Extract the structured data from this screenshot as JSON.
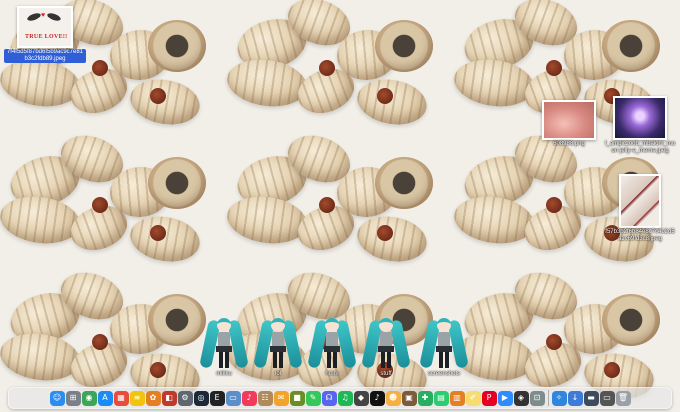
{
  "desktop": {
    "icons": [
      {
        "id": "truelove",
        "label": "7f4f5d5f87bd6f5b9ac9c7e81b3c2fdb89.jpeg",
        "thumb_text": "TRUE LOVE!!",
        "selected": true
      },
      {
        "id": "pink",
        "label": "608988.png",
        "selected": false
      },
      {
        "id": "jelly",
        "label": "f_ampiczoob_mbalom_moon-jelly-e_meme.jpeg",
        "selected": false
      },
      {
        "id": "wings",
        "label": "f57b3b2f6b84e8c7c4b2d5a1c69fd3c8.jpeg",
        "selected": false
      },
      {
        "id": "miku1",
        "label": "mikku",
        "selected": false
      },
      {
        "id": "miku2",
        "label": "lol",
        "selected": false
      },
      {
        "id": "miku3",
        "label": "hmm",
        "selected": false
      },
      {
        "id": "miku4",
        "label": "stuff",
        "selected": false
      },
      {
        "id": "miku5",
        "label": "screenshots",
        "selected": false
      }
    ]
  },
  "dock": {
    "apps": [
      {
        "icon": "finder-icon",
        "glyph": "☺",
        "color": "#2a8df0"
      },
      {
        "icon": "launchpad-icon",
        "glyph": "⊞",
        "color": "#7a7f88"
      },
      {
        "icon": "chrome-icon",
        "glyph": "◉",
        "color": "#3aa757"
      },
      {
        "icon": "app-store-icon",
        "glyph": "A",
        "color": "#1a8cf7"
      },
      {
        "icon": "calendar-icon",
        "glyph": "▦",
        "color": "#e74c3c"
      },
      {
        "icon": "notes-icon",
        "glyph": "≡",
        "color": "#f1c40f"
      },
      {
        "icon": "photos-icon",
        "glyph": "✿",
        "color": "#e67e22"
      },
      {
        "icon": "photo-booth-icon",
        "glyph": "◧",
        "color": "#c0392b"
      },
      {
        "icon": "system-preferences-icon",
        "glyph": "⚙",
        "color": "#5f6670"
      },
      {
        "icon": "steam-icon",
        "glyph": "◎",
        "color": "#1b2838"
      },
      {
        "icon": "epic-games-icon",
        "glyph": "E",
        "color": "#222"
      },
      {
        "icon": "preview-icon",
        "glyph": "▭",
        "color": "#5b8fc9"
      },
      {
        "icon": "music-icon",
        "glyph": "♪",
        "color": "#f23b5b"
      },
      {
        "icon": "contacts-icon",
        "glyph": "☷",
        "color": "#b08a5a"
      },
      {
        "icon": "messages-icon",
        "glyph": "✉",
        "color": "#f3a32c"
      },
      {
        "icon": "minecraft-icon",
        "glyph": "■",
        "color": "#6b8e23"
      },
      {
        "icon": "chat-icon",
        "glyph": "✎",
        "color": "#34c759"
      },
      {
        "icon": "discord-icon",
        "glyph": "☊",
        "color": "#5865f2"
      },
      {
        "icon": "spotify-icon",
        "glyph": "♫",
        "color": "#1db954"
      },
      {
        "icon": "game-icon",
        "glyph": "◆",
        "color": "#444"
      },
      {
        "icon": "tiktok-icon",
        "glyph": "♪",
        "color": "#111"
      },
      {
        "icon": "character-icon",
        "glyph": "☻",
        "color": "#f5b041"
      },
      {
        "icon": "minecraft-dungeons-icon",
        "glyph": "▣",
        "color": "#7d5a3c"
      },
      {
        "icon": "crossy-icon",
        "glyph": "✚",
        "color": "#27ae60"
      },
      {
        "icon": "numbers-icon",
        "glyph": "▤",
        "color": "#2ecc71"
      },
      {
        "icon": "pages-icon",
        "glyph": "▥",
        "color": "#e67e22"
      },
      {
        "icon": "notes-yellow-icon",
        "glyph": "✐",
        "color": "#f7dc6f"
      },
      {
        "icon": "pinterest-icon",
        "glyph": "P",
        "color": "#e60023"
      },
      {
        "icon": "zoom-icon",
        "glyph": "▶",
        "color": "#2d8cff"
      },
      {
        "icon": "roblox-icon",
        "glyph": "◈",
        "color": "#333"
      },
      {
        "icon": "screenshot-icon",
        "glyph": "⊡",
        "color": "#7f8c8d"
      }
    ],
    "trailing": [
      {
        "icon": "safari-icon",
        "glyph": "✧",
        "color": "#2e86de"
      },
      {
        "icon": "downloads-icon",
        "glyph": "↓",
        "color": "#3d7bd9"
      },
      {
        "icon": "folder-icon",
        "glyph": "▬",
        "color": "#3d4b5c"
      },
      {
        "icon": "screen-icon",
        "glyph": "▭",
        "color": "#555"
      },
      {
        "icon": "trash-icon",
        "glyph": "🗑",
        "color": "#9aa0a6"
      }
    ]
  }
}
